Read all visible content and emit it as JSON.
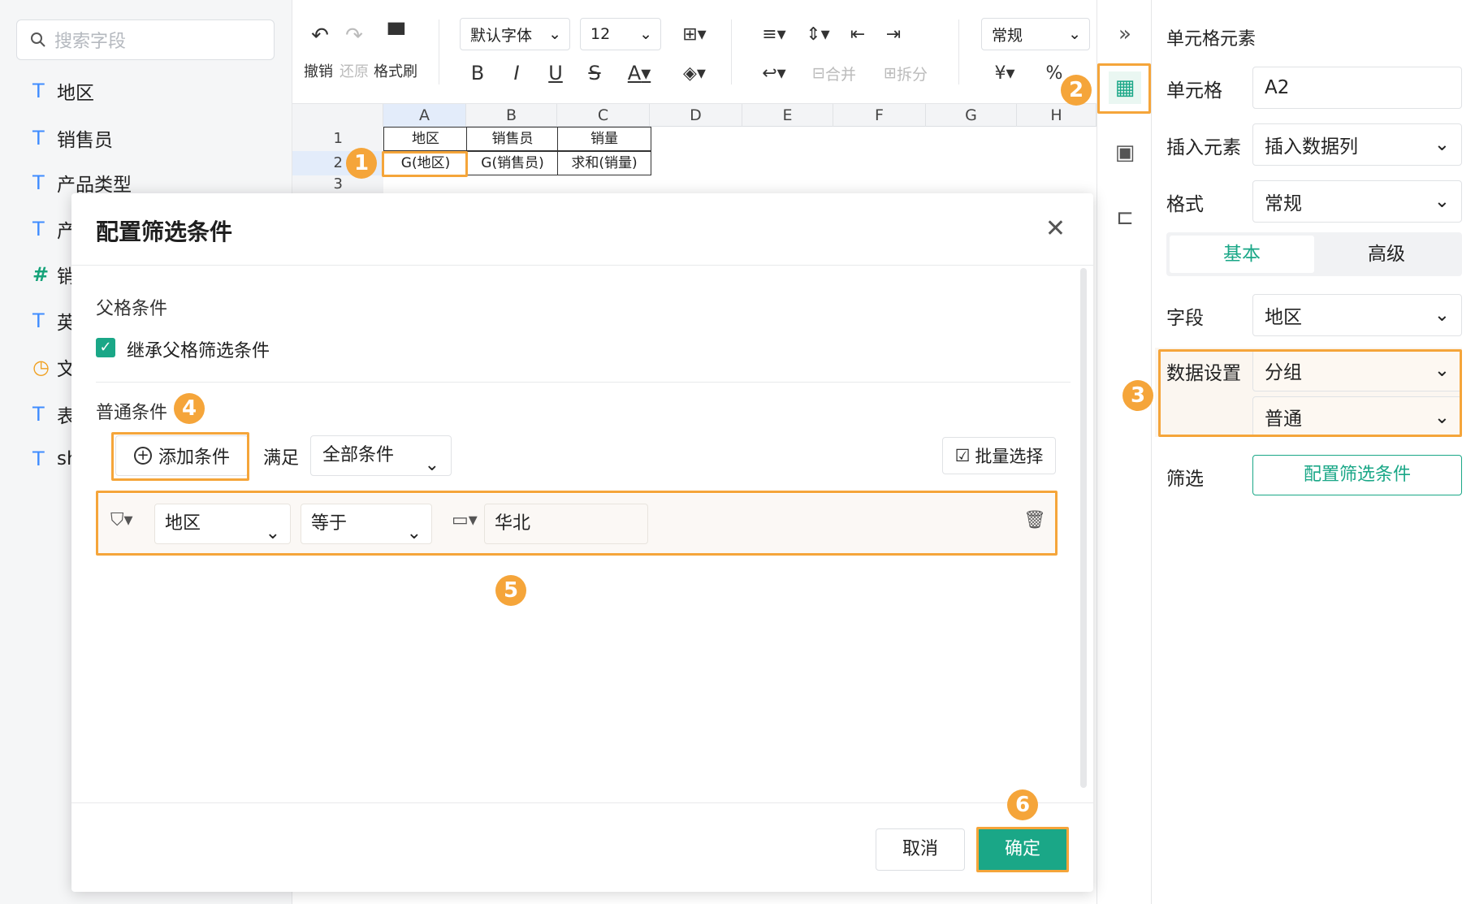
{
  "left_panel": {
    "search_placeholder": "搜索字段",
    "fields": [
      {
        "type": "T",
        "label": "地区"
      },
      {
        "type": "T",
        "label": "销售员"
      },
      {
        "type": "T",
        "label": "产品类型"
      },
      {
        "type": "T",
        "label": "产"
      },
      {
        "type": "#",
        "label": "销"
      },
      {
        "type": "T",
        "label": "英"
      },
      {
        "type": "clock",
        "label": "文"
      },
      {
        "type": "T",
        "label": "表"
      },
      {
        "type": "T",
        "label": "sh"
      }
    ]
  },
  "toolbar": {
    "undo_label": "撤销",
    "redo_label": "还原",
    "format_painter_label": "格式刷",
    "font_family": "默认字体",
    "font_size": "12",
    "bold": "B",
    "italic": "I",
    "underline": "U",
    "strike": "S",
    "font_color": "A",
    "merge_label": "合并",
    "split_label": "拆分",
    "number_format": "常规",
    "currency": "¥",
    "percent": "%"
  },
  "sheet": {
    "columns": [
      "A",
      "B",
      "C",
      "D",
      "E",
      "F",
      "G",
      "H"
    ],
    "rows": [
      "1",
      "2",
      "3"
    ],
    "row1": [
      "地区",
      "销售员",
      "销量"
    ],
    "row2": [
      "G(地区)",
      "G(销售员)",
      "求和(销量)"
    ]
  },
  "right_panel": {
    "title": "单元格元素",
    "cell_label": "单元格",
    "cell_value": "A2",
    "insert_label": "插入元素",
    "insert_value": "插入数据列",
    "format_label": "格式",
    "format_value": "常规",
    "tab_basic": "基本",
    "tab_advanced": "高级",
    "field_label": "字段",
    "field_value": "地区",
    "data_setting_label": "数据设置",
    "data_setting_value1": "分组",
    "data_setting_value2": "普通",
    "filter_label": "筛选",
    "filter_button": "配置筛选条件"
  },
  "modal": {
    "title": "配置筛选条件",
    "parent_cond_label": "父格条件",
    "inherit_label": "继承父格筛选条件",
    "normal_cond_label": "普通条件",
    "add_cond": "添加条件",
    "satisfy_label": "满足",
    "satisfy_value": "全部条件",
    "batch_select": "批量选择",
    "condition": {
      "field": "地区",
      "operator": "等于",
      "value": "华北"
    },
    "cancel": "取消",
    "ok": "确定"
  },
  "annotations": [
    "1",
    "2",
    "3",
    "4",
    "5",
    "6"
  ],
  "colors": {
    "accent": "#1aa787",
    "highlight": "#f5a53a",
    "field_type": "#3f8cff"
  }
}
